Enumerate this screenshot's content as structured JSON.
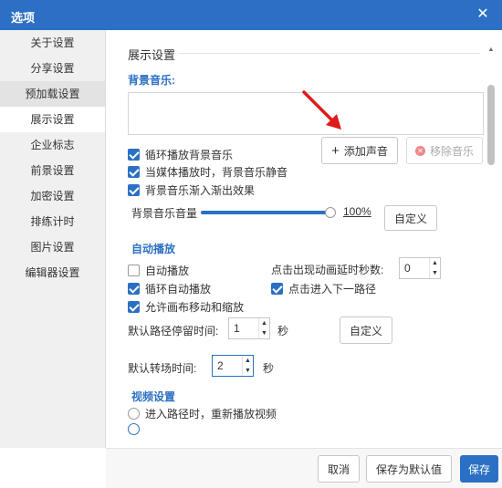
{
  "window": {
    "title": "选项",
    "close_glyph": "✕"
  },
  "sidebar": {
    "items": [
      {
        "label": "关于设置"
      },
      {
        "label": "分享设置"
      },
      {
        "label": "预加载设置"
      },
      {
        "label": "展示设置"
      },
      {
        "label": "企业标志"
      },
      {
        "label": "前景设置"
      },
      {
        "label": "加密设置"
      },
      {
        "label": "排练计时"
      },
      {
        "label": "图片设置"
      },
      {
        "label": "编辑器设置"
      }
    ],
    "active": "展示设置"
  },
  "display": {
    "section_title": "展示设置",
    "bg_music": {
      "heading": "背景音乐:",
      "loop_label": "循环播放背景音乐",
      "mute_label": "当媒体播放时，背景音乐静音",
      "fade_label": "背景音乐渐入渐出效果",
      "add_label": "添加声音",
      "remove_label": "移除音乐",
      "volume_label": "背景音乐音量",
      "volume_value": "100%",
      "volume_fraction": 1.0,
      "custom_label": "自定义"
    },
    "autoplay": {
      "heading": "自动播放",
      "auto_label": "自动播放",
      "loop_auto_label": "循环自动播放",
      "allow_move_label": "允许画布移动和缩放",
      "delay_label": "点击出现动画延时秒数:",
      "delay_value": "0",
      "next_path_label": "点击进入下一路径",
      "stay_label": "默认路径停留时间:",
      "stay_value": "1",
      "stay_unit": "秒",
      "custom_label": "自定义",
      "transition_label": "默认转场时间:",
      "transition_value": "2",
      "transition_unit": "秒"
    },
    "video": {
      "heading": "视频设置",
      "replay_label": "进入路径时，重新播放视频"
    }
  },
  "footer": {
    "cancel_label": "取消",
    "save_default_label": "保存为默认值",
    "save_label": "保存"
  },
  "colors": {
    "accent": "#2b70c4",
    "arrow": "#e01b1b"
  },
  "icons": {
    "add": "plus-icon",
    "remove": "remove-circle-icon",
    "close": "close-icon",
    "arrow": "red-arrow-annotation"
  }
}
